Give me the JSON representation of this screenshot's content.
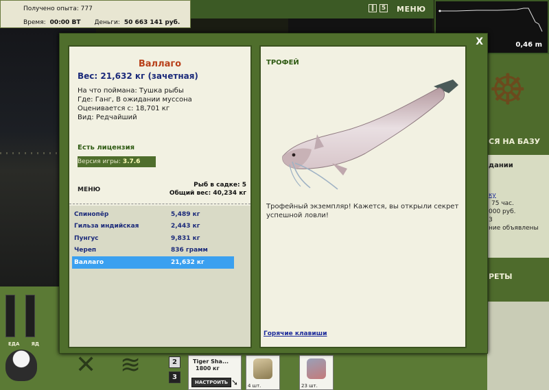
{
  "stats": {
    "exp_label": "Получено опыта:",
    "exp_value": "777",
    "time_label": "Время:",
    "time_value": "00:00 ВТ",
    "money_label": "Деньги:",
    "money_value": "50 663 141 руб."
  },
  "top": {
    "pause_icon": "pause-icon",
    "speed_label": "5",
    "menu_label": "МЕНЮ"
  },
  "depth": {
    "value": "0,46 m"
  },
  "right_panel": {
    "base_label": "СЯ НА БАЗУ",
    "card_title": "дании",
    "card_link": "ку",
    "card_l1": "75 час.",
    "card_l2": "000 руб.",
    "card_l3": "3",
    "card_l4": "ние объявлены",
    "secrets_label": "РЕТЫ"
  },
  "bottom": {
    "gauge_food": "ЕДА",
    "gauge_poison": "ЯД",
    "slot2": "2",
    "slot3": "3",
    "lure_name": "Tiger Sha...",
    "lure_weight": "1800 кг",
    "lure_button": "НАСТРОИТЬ",
    "item1_count": "4 шт.",
    "item2_count": "23 шт."
  },
  "modal": {
    "close_label": "X",
    "fish_name": "Валлаго",
    "fish_weight": "Вес: 21,632 кг (зачетная)",
    "caught_on": "На что поймана: Тушка рыбы",
    "location": "Где: Ганг, В ожидании муссона",
    "valued_from": "Оценивается с: 18,701 кг",
    "species": "Вид: Редчайший",
    "license": "Есть лицензия",
    "version_label": "Версия игры:",
    "version_value": "3.7.6",
    "menu_label": "МЕНЮ",
    "keep_count": "Рыб в садке: 5",
    "total_weight": "Общий вес: 40,234 кг",
    "fish_list": [
      {
        "name": "Спинопёр",
        "weight": "5,489 кг",
        "selected": false
      },
      {
        "name": "Гильза индийская",
        "weight": "2,443 кг",
        "selected": false
      },
      {
        "name": "Пунгус",
        "weight": "9,831 кг",
        "selected": false
      },
      {
        "name": "Череп",
        "weight": "836 грамм",
        "selected": false
      },
      {
        "name": "Валлаго",
        "weight": "21,632 кг",
        "selected": true
      }
    ],
    "trophy_title": "ТРОФЕЙ",
    "trophy_desc": "Трофейный экземпляр! Кажется, вы открыли секрет успешной ловли!",
    "hotkeys": "Горячие клавиши"
  },
  "colors": {
    "panel_green": "#4f6e2c",
    "name_orange": "#b8401a",
    "list_blue": "#1b2a7a",
    "selected_bg": "#3aa0f0"
  }
}
